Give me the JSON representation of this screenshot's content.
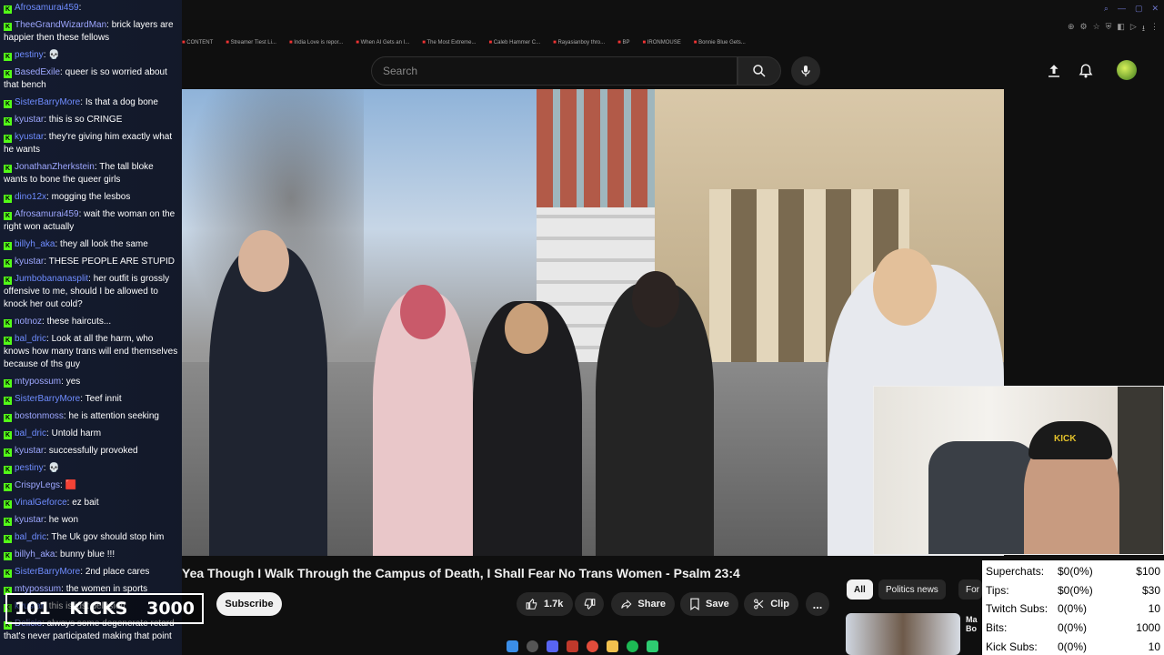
{
  "browser": {
    "tabs": [
      "CONTENT",
      "Streamer Tiest Li...",
      "India Love is repor...",
      "When AI Gets an I...",
      "The Most Extreme...",
      "Caleb Hammer C...",
      "Rayasianboy thro...",
      "BP",
      "IRONMOUSE",
      "Bonnie Blue Gets..."
    ]
  },
  "youtube": {
    "search_placeholder": "Search",
    "video_title": "Yea Though I Walk Through the Campus of Death, I Shall Fear No Trans Women - Psalm 23:4",
    "subscribe_label": "Subscribe",
    "like_count": "1.7k",
    "share_label": "Share",
    "save_label": "Save",
    "clip_label": "Clip",
    "more_label": "...",
    "chips": [
      "All",
      "Politics news",
      "For"
    ],
    "up_next_title": "Ma Bo"
  },
  "chat": {
    "badge": "K",
    "messages": [
      {
        "user": "Afrosamurai459",
        "text": ""
      },
      {
        "user": "TheeGrandWizardMan",
        "text": "brick layers are happier then these fellows"
      },
      {
        "user": "pestiny",
        "text": "💀"
      },
      {
        "user": "BasedExile",
        "text": "queer is so worried about that bench"
      },
      {
        "user": "SisterBarryMore",
        "text": "Is that a dog bone"
      },
      {
        "user": "kyustar",
        "text": "this is so CRINGE"
      },
      {
        "user": "kyustar",
        "text": "they're giving him exactly what he wants"
      },
      {
        "user": "JonathanZherkstein",
        "text": "The tall bloke wants to bone the queer girls"
      },
      {
        "user": "dino12x",
        "text": "mogging the lesbos"
      },
      {
        "user": "Afrosamurai459",
        "text": "wait the woman on the right won actually"
      },
      {
        "user": "billyh_aka",
        "text": "they all look the same"
      },
      {
        "user": "kyustar",
        "text": "THESE PEOPLE ARE STUPID"
      },
      {
        "user": "Jumbobananasplit",
        "text": "her outfit is grossly offensive to me, should I be allowed to knock her out cold?"
      },
      {
        "user": "notnoz",
        "text": "these haircuts..."
      },
      {
        "user": "bal_dric",
        "text": "Look at all the harm, who knows how many trans will end themselves because of ths guy"
      },
      {
        "user": "mtypossum",
        "text": "yes"
      },
      {
        "user": "SisterBarryMore",
        "text": "Teef innit"
      },
      {
        "user": "bostonmoss",
        "text": "he is attention seeking"
      },
      {
        "user": "bal_dric",
        "text": "Untold harm"
      },
      {
        "user": "kyustar",
        "text": "successfully provoked"
      },
      {
        "user": "pestiny",
        "text": "💀"
      },
      {
        "user": "CrispyLegs",
        "text": "🟥"
      },
      {
        "user": "VinalGeforce",
        "text": "ez bait"
      },
      {
        "user": "kyustar",
        "text": "he won"
      },
      {
        "user": "bal_dric",
        "text": "The Uk gov should stop him"
      },
      {
        "user": "billyh_aka",
        "text": "bunny blue !!!"
      },
      {
        "user": "SisterBarryMore",
        "text": "2nd place cares"
      },
      {
        "user": "mtypossum",
        "text": "the women in sports"
      },
      {
        "user": "kyustar",
        "text": "this is just delusion"
      },
      {
        "user": "Delicio",
        "text": "always some degenerate retard that's never participated making that point"
      }
    ]
  },
  "kicks_counter": {
    "count": "101",
    "label": "KICKS",
    "goal": "3000"
  },
  "webcam": {
    "cap_text": "KICK"
  },
  "donations": {
    "rows": [
      {
        "label": "Superchats:",
        "value": "$0(0%)",
        "goal": "$100"
      },
      {
        "label": "Tips:",
        "value": "$0(0%)",
        "goal": "$30"
      },
      {
        "label": "Twitch Subs:",
        "value": "0(0%)",
        "goal": "10"
      },
      {
        "label": "Bits:",
        "value": "0(0%)",
        "goal": "1000"
      },
      {
        "label": "Kick Subs:",
        "value": "0(0%)",
        "goal": "10"
      }
    ]
  },
  "colors": {
    "kick_green": "#53fc18",
    "username_blue": "#6f8cff",
    "yt_bg": "#0f0f0f"
  }
}
